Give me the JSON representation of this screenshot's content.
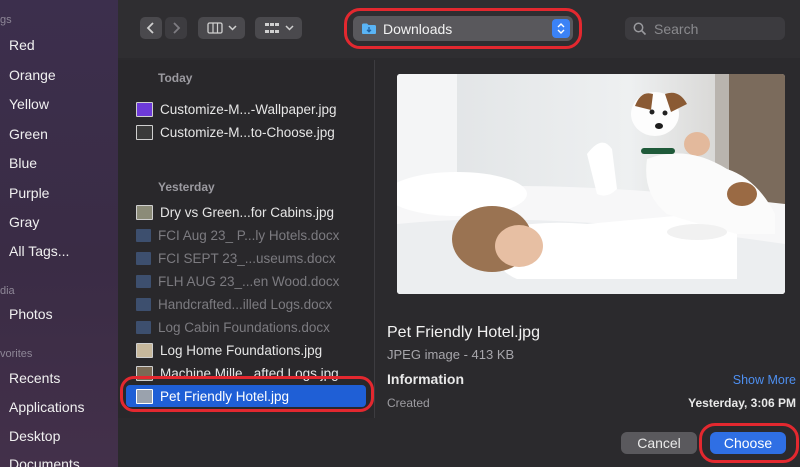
{
  "sidebar": {
    "sections": {
      "tags_partial": "gs",
      "media_partial": "dia",
      "favorites_partial": "vorites"
    },
    "tags": [
      {
        "label": "Red",
        "color": "#ff5f57"
      },
      {
        "label": "Orange",
        "color": "#ff9f0a"
      },
      {
        "label": "Yellow",
        "color": "#ffd60a"
      },
      {
        "label": "Green",
        "color": "#32d74b"
      },
      {
        "label": "Blue",
        "color": "#0a84ff"
      },
      {
        "label": "Purple",
        "color": "#bf5af2"
      },
      {
        "label": "Gray",
        "color": "#98989d"
      },
      {
        "label": "All Tags...",
        "color": ""
      }
    ],
    "media": [
      {
        "label": "Photos",
        "icon": "photos-icon"
      }
    ],
    "favorites": [
      {
        "label": "Recents",
        "icon": "clock-icon"
      },
      {
        "label": "Applications",
        "icon": "applications-icon"
      },
      {
        "label": "Desktop",
        "icon": "desktop-icon"
      },
      {
        "label": "Documents",
        "icon": "documents-icon"
      }
    ]
  },
  "toolbar": {
    "back_icon": "chevron-left-icon",
    "forward_icon": "chevron-right-icon",
    "view_columns_icon": "columns-view-icon",
    "group_icon": "grid-group-icon",
    "location": "Downloads",
    "search_placeholder": "Search"
  },
  "files": {
    "groups": [
      {
        "title": "Today",
        "items": [
          {
            "name": "Customize-M...-Wallpaper.jpg",
            "type": "jpg",
            "dim": false
          },
          {
            "name": "Customize-M...to-Choose.jpg",
            "type": "jpg",
            "dim": false
          }
        ]
      },
      {
        "title": "Yesterday",
        "items": [
          {
            "name": "Dry vs Green...for Cabins.jpg",
            "type": "jpg",
            "dim": false
          },
          {
            "name": "FCI Aug 23_ P...ly Hotels.docx",
            "type": "docx",
            "dim": true
          },
          {
            "name": "FCI SEPT 23_...useums.docx",
            "type": "docx",
            "dim": true
          },
          {
            "name": "FLH AUG 23_...en Wood.docx",
            "type": "docx",
            "dim": true
          },
          {
            "name": "Handcrafted...illed Logs.docx",
            "type": "docx",
            "dim": true
          },
          {
            "name": "Log Cabin Foundations.docx",
            "type": "docx",
            "dim": true
          },
          {
            "name": "Log Home Foundations.jpg",
            "type": "jpg",
            "dim": false
          },
          {
            "name": "Machine Mille...afted Logs.jpg",
            "type": "jpg",
            "dim": false
          },
          {
            "name": "Pet Friendly Hotel.jpg",
            "type": "jpg",
            "dim": false,
            "selected": true
          }
        ]
      }
    ]
  },
  "preview": {
    "filename": "Pet Friendly Hotel.jpg",
    "kind": "JPEG image - 413 KB",
    "info_heading": "Information",
    "show_more": "Show More",
    "created_label": "Created",
    "created_value": "Yesterday, 3:06 PM"
  },
  "buttons": {
    "cancel": "Cancel",
    "choose": "Choose"
  },
  "colors": {
    "accent": "#2f6fe4",
    "highlight_ring": "#e3282f",
    "selection": "#1f5fd6"
  }
}
